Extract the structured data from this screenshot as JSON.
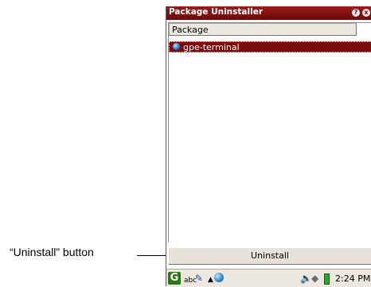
{
  "annotation": {
    "callout_text": "“Uninstall” button"
  },
  "window": {
    "title": "Package Uninstaller",
    "help_button_glyph": "?",
    "close_button_glyph": "x"
  },
  "list": {
    "column_header": "Package",
    "items": [
      {
        "label": "gpe-terminal",
        "icon": "package-globe-icon",
        "selected": true
      }
    ]
  },
  "actions": {
    "uninstall_label": "Uninstall"
  },
  "taskbar": {
    "launcher_glyph": "G",
    "input_method": "abc",
    "clock": "2:24 PM"
  },
  "colors": {
    "titlebar": "#7a0c0c",
    "selection": "#7a0c0c",
    "panel": "#ece8e0"
  }
}
